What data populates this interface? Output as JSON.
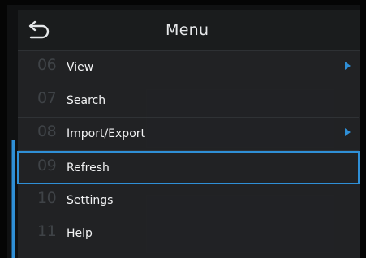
{
  "menu": {
    "title": "Menu",
    "items": [
      {
        "number": "06",
        "label": "View",
        "has_submenu": true
      },
      {
        "number": "07",
        "label": "Search",
        "has_submenu": false
      },
      {
        "number": "08",
        "label": "Import/Export",
        "has_submenu": true
      },
      {
        "number": "09",
        "label": "Refresh",
        "has_submenu": false,
        "selected": true
      },
      {
        "number": "10",
        "label": "Settings",
        "has_submenu": false
      },
      {
        "number": "11",
        "label": "Help",
        "has_submenu": false
      }
    ]
  },
  "icons": {
    "back": "back-arrow-icon",
    "submenu": "chevron-right-icon"
  },
  "colors": {
    "accent": "#2f8fd6",
    "menu_bg": "#222426",
    "text": "#f2f3f4",
    "number_text": "#3f4347"
  }
}
